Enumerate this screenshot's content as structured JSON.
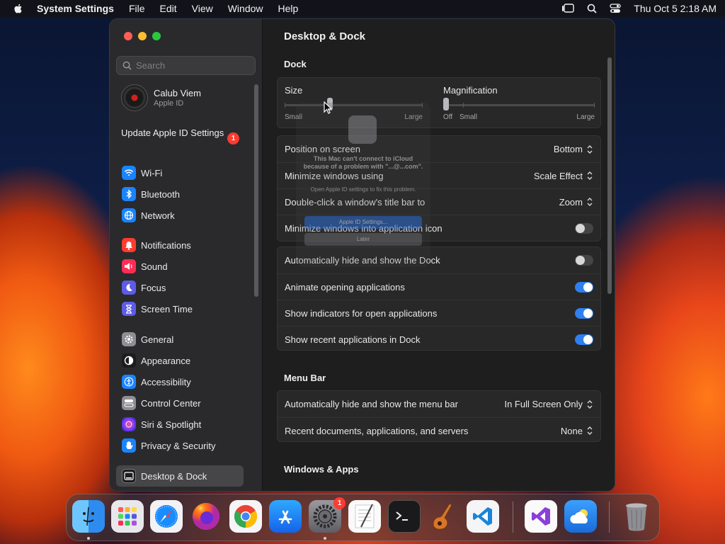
{
  "menubar": {
    "app_name": "System Settings",
    "items": [
      "File",
      "Edit",
      "View",
      "Window",
      "Help"
    ],
    "clock": "Thu Oct 5  2:18 AM"
  },
  "sidebar": {
    "search_placeholder": "Search",
    "account": {
      "name": "Calub Viem",
      "subtitle": "Apple ID"
    },
    "update_label": "Update Apple ID Settings",
    "update_badge": "1",
    "groups": [
      [
        {
          "label": "Wi-Fi",
          "icon": "wifi-icon",
          "color": "#1a84ff"
        },
        {
          "label": "Bluetooth",
          "icon": "bluetooth-icon",
          "color": "#1a84ff"
        },
        {
          "label": "Network",
          "icon": "globe-icon",
          "color": "#1a84ff"
        }
      ],
      [
        {
          "label": "Notifications",
          "icon": "bell-icon",
          "color": "#ff3b30"
        },
        {
          "label": "Sound",
          "icon": "speaker-icon",
          "color": "#ff2d55"
        },
        {
          "label": "Focus",
          "icon": "moon-icon",
          "color": "#5e5ce6"
        },
        {
          "label": "Screen Time",
          "icon": "hourglass-icon",
          "color": "#5e5ce6"
        }
      ],
      [
        {
          "label": "General",
          "icon": "gear-icon",
          "color": "#8e8e93"
        },
        {
          "label": "Appearance",
          "icon": "appearance-icon",
          "color": "#1c1c1e"
        },
        {
          "label": "Accessibility",
          "icon": "accessibility-icon",
          "color": "#1a84ff"
        },
        {
          "label": "Control Center",
          "icon": "control-center-icon",
          "color": "#8e8e93"
        },
        {
          "label": "Siri & Spotlight",
          "icon": "siri-icon",
          "color": "#b83ad8"
        },
        {
          "label": "Privacy & Security",
          "icon": "hand-icon",
          "color": "#1a84ff"
        }
      ],
      [
        {
          "label": "Desktop & Dock",
          "icon": "dock-icon",
          "color": "#1c1c1e",
          "active": true
        }
      ]
    ]
  },
  "main": {
    "title": "Desktop & Dock",
    "dock_section": "Dock",
    "size_slider": {
      "label": "Size",
      "min_label": "Small",
      "max_label": "Large",
      "value_fraction": 0.2
    },
    "magnification_slider": {
      "label": "Magnification",
      "off_label": "Off",
      "min_label": "Small",
      "max_label": "Large",
      "value_fraction": 0.0
    },
    "settings_rows": [
      {
        "label": "Position on screen",
        "type": "select",
        "value": "Bottom"
      },
      {
        "label": "Minimize windows using",
        "type": "select",
        "value": "Scale Effect"
      },
      {
        "label": "Double-click a window's title bar to",
        "type": "select",
        "value": "Zoom"
      },
      {
        "label": "Minimize windows into application icon",
        "type": "toggle",
        "on": false
      }
    ],
    "behavior_rows": [
      {
        "label": "Automatically hide and show the Dock",
        "type": "toggle",
        "on": false
      },
      {
        "label": "Animate opening applications",
        "type": "toggle",
        "on": true
      },
      {
        "label": "Show indicators for open applications",
        "type": "toggle",
        "on": true
      },
      {
        "label": "Show recent applications in Dock",
        "type": "toggle",
        "on": true
      }
    ],
    "menubar_section": "Menu Bar",
    "menubar_rows": [
      {
        "label": "Automatically hide and show the menu bar",
        "type": "select",
        "value": "In Full Screen Only"
      },
      {
        "label": "Recent documents, applications, and servers",
        "type": "select",
        "value": "None"
      }
    ],
    "windows_section": "Windows & Apps"
  },
  "alert": {
    "title": "This Mac can't connect to iCloud because of a problem with \"...@...com\".",
    "message": "Open Apple ID settings to fix this problem.",
    "primary_button": "Apple ID Settings...",
    "secondary_button": "Later"
  },
  "dock": {
    "apps": [
      {
        "name": "Finder",
        "icon": "finder-icon",
        "running": true
      },
      {
        "name": "Launchpad",
        "icon": "launchpad-icon"
      },
      {
        "name": "Safari",
        "icon": "safari-icon"
      },
      {
        "name": "Firefox",
        "icon": "firefox-icon"
      },
      {
        "name": "Chrome",
        "icon": "chrome-icon"
      },
      {
        "name": "App Store",
        "icon": "app-store-icon"
      },
      {
        "name": "System Settings",
        "icon": "system-settings-icon",
        "running": true,
        "badge": "1"
      },
      {
        "name": "TextEdit",
        "icon": "textedit-icon"
      },
      {
        "name": "Terminal",
        "icon": "terminal-icon"
      },
      {
        "name": "GarageBand",
        "icon": "garageband-icon"
      },
      {
        "name": "Visual Studio Code",
        "icon": "vscode-icon"
      },
      {
        "name": "Visual Studio",
        "icon": "visual-studio-icon"
      },
      {
        "name": "Weather",
        "icon": "weather-icon"
      },
      {
        "name": "Trash",
        "icon": "trash-icon"
      }
    ]
  }
}
